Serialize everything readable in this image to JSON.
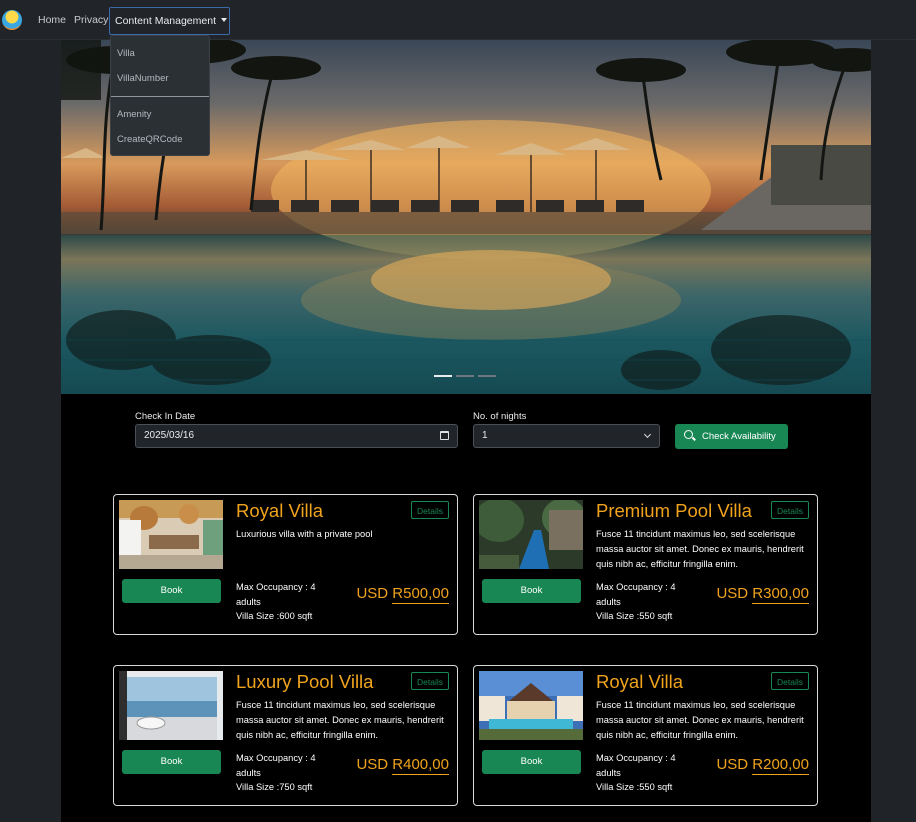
{
  "nav": {
    "home": "Home",
    "privacy": "Privacy",
    "content_management": "Content Management",
    "dropdown": [
      "Villa",
      "VillaNumber",
      "Amenity",
      "CreateQRCode"
    ]
  },
  "search": {
    "checkin_label": "Check In Date",
    "checkin_value": "2025/03/16",
    "nights_label": "No. of nights",
    "nights_value": "1",
    "check_button": "Check Availability"
  },
  "villas": [
    {
      "name": "Royal Villa",
      "details": "Details",
      "description": "Luxurious villa with a private pool",
      "book": "Book",
      "occupancy": "Max Occupancy : 4 adults",
      "size": "Villa Size :600 sqft",
      "currency": "USD",
      "price": "R500,00"
    },
    {
      "name": "Premium Pool Villa",
      "details": "Details",
      "description": "Fusce 11 tincidunt maximus leo, sed scelerisque massa auctor sit amet. Donec ex mauris, hendrerit quis nibh ac, efficitur fringilla enim.",
      "book": "Book",
      "occupancy": "Max Occupancy : 4 adults",
      "size": "Villa Size :550 sqft",
      "currency": "USD",
      "price": "R300,00"
    },
    {
      "name": "Luxury Pool Villa",
      "details": "Details",
      "description": "Fusce 11 tincidunt maximus leo, sed scelerisque massa auctor sit amet. Donec ex mauris, hendrerit quis nibh ac, efficitur fringilla enim.",
      "book": "Book",
      "occupancy": "Max Occupancy : 4 adults",
      "size": "Villa Size :750 sqft",
      "currency": "USD",
      "price": "R400,00"
    },
    {
      "name": "Royal Villa",
      "details": "Details",
      "description": "Fusce 11 tincidunt maximus leo, sed scelerisque massa auctor sit amet. Donec ex mauris, hendrerit quis nibh ac, efficitur fringilla enim.",
      "book": "Book",
      "occupancy": "Max Occupancy : 4 adults",
      "size": "Villa Size :550 sqft",
      "currency": "USD",
      "price": "R200,00"
    }
  ],
  "colors": {
    "accent": "#198754",
    "title": "#f0a31d",
    "navbar": "#212529"
  }
}
